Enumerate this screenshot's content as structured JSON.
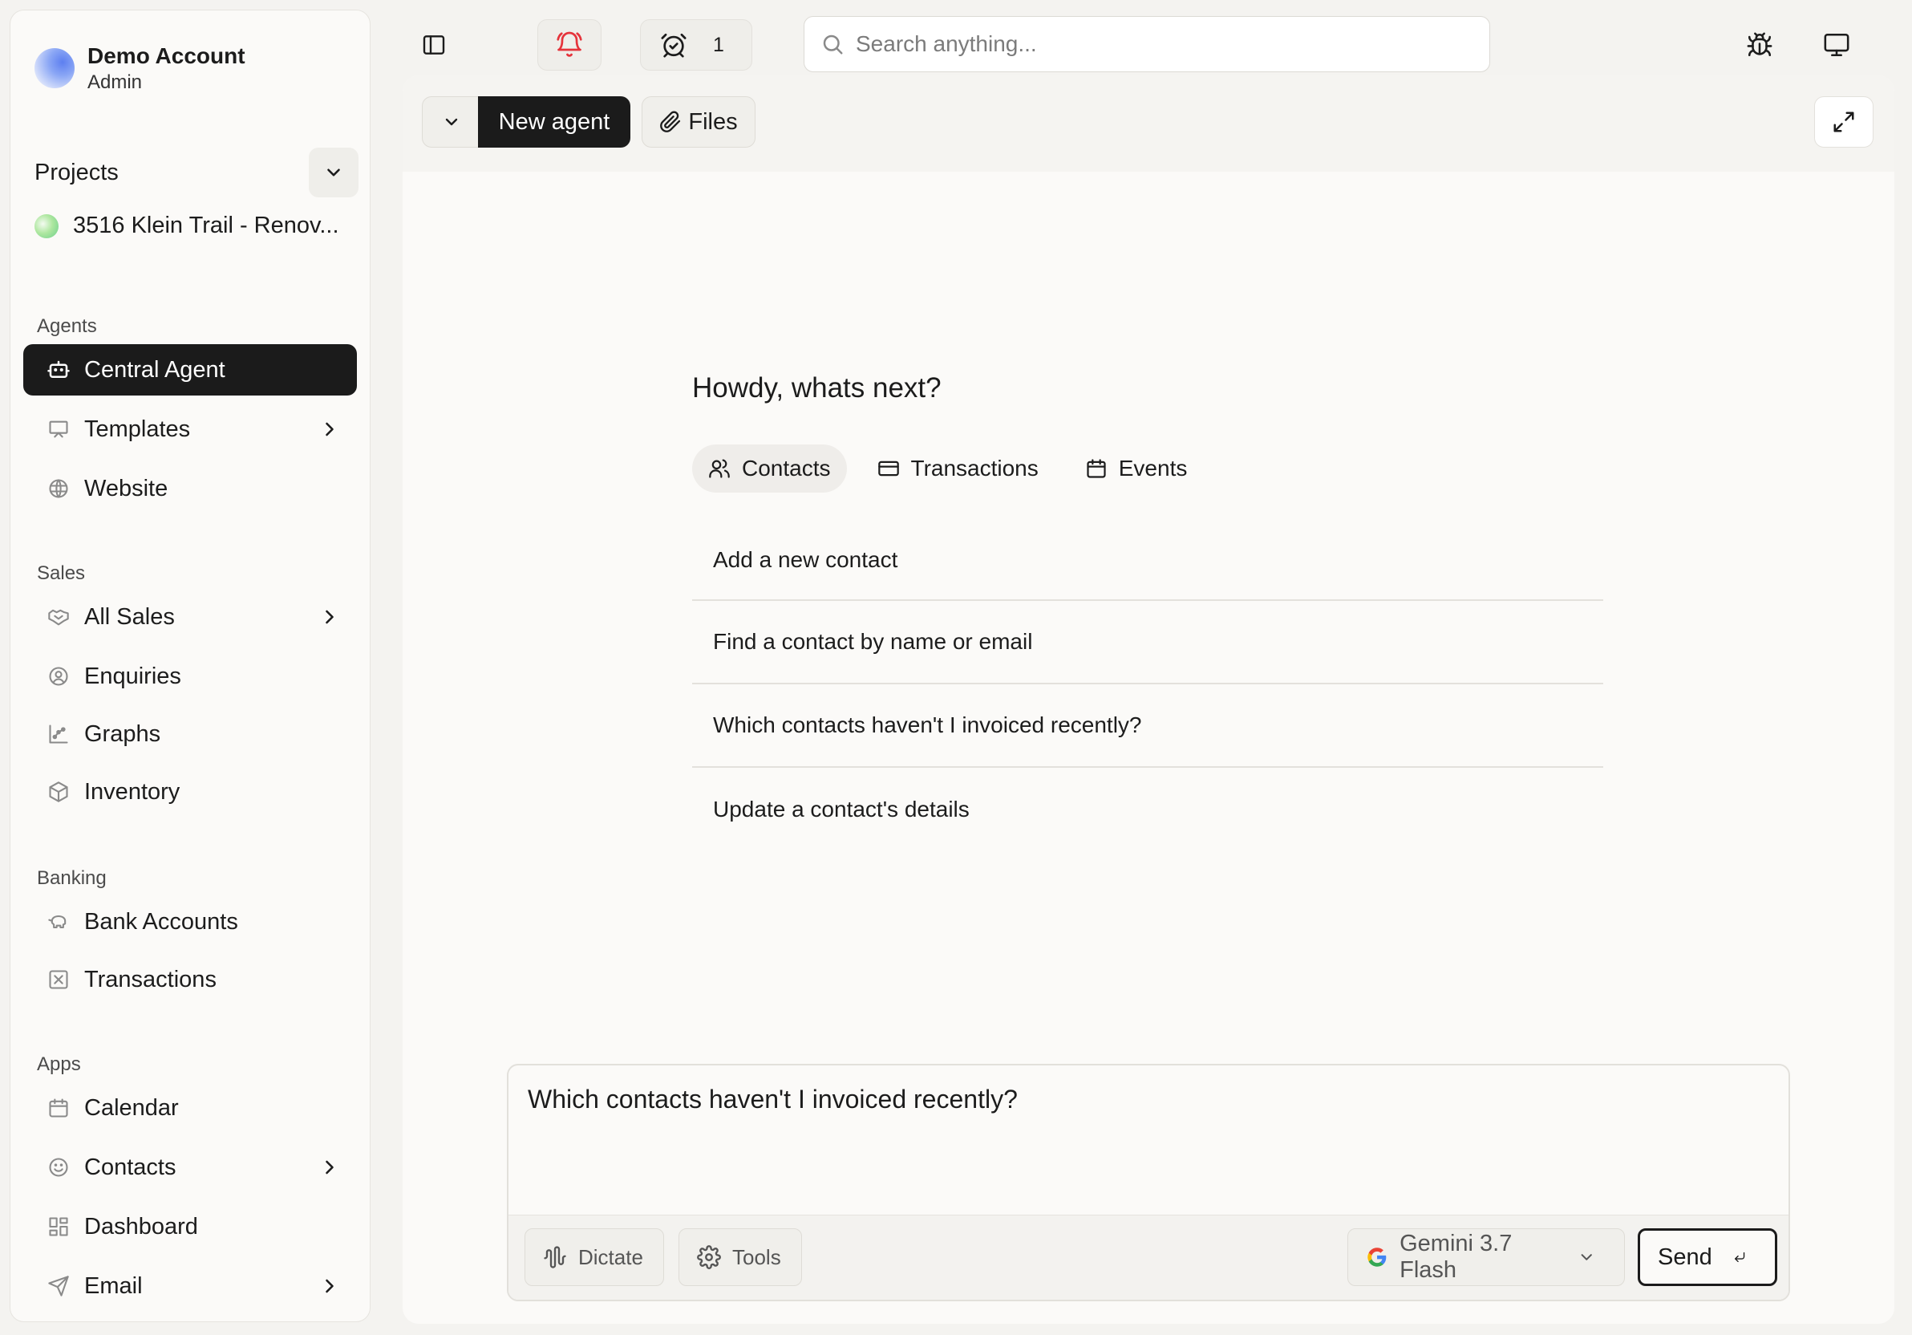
{
  "account": {
    "name": "Demo Account",
    "role": "Admin"
  },
  "projects": {
    "label": "Projects",
    "items": [
      "3516 Klein Trail - Renov..."
    ]
  },
  "sidebar": {
    "sections": {
      "agents": "Agents",
      "sales": "Sales",
      "banking": "Banking",
      "apps": "Apps"
    },
    "items": {
      "central_agent": "Central Agent",
      "templates": "Templates",
      "website": "Website",
      "all_sales": "All Sales",
      "enquiries": "Enquiries",
      "graphs": "Graphs",
      "inventory": "Inventory",
      "bank_accounts": "Bank Accounts",
      "transactions": "Transactions",
      "calendar": "Calendar",
      "contacts": "Contacts",
      "dashboard": "Dashboard",
      "email": "Email"
    }
  },
  "topbar": {
    "alarm_count": "1",
    "search_placeholder": "Search anything..."
  },
  "main": {
    "new_agent_label": "New agent",
    "files_label": "Files",
    "greeting": "Howdy, whats next?",
    "tabs": [
      "Contacts",
      "Transactions",
      "Events"
    ],
    "suggestions": [
      "Add a new contact",
      "Find a contact by name or email",
      "Which contacts haven't I invoiced recently?",
      "Update a contact's details"
    ]
  },
  "composer": {
    "text": "Which contacts haven't I invoiced recently?",
    "dictate_label": "Dictate",
    "tools_label": "Tools",
    "model_label": "Gemini 3.7 Flash",
    "send_label": "Send"
  },
  "colors": {
    "accent_dark": "#1b1b1b",
    "bell_red": "#e5333b",
    "background": "#f4f3f0"
  }
}
